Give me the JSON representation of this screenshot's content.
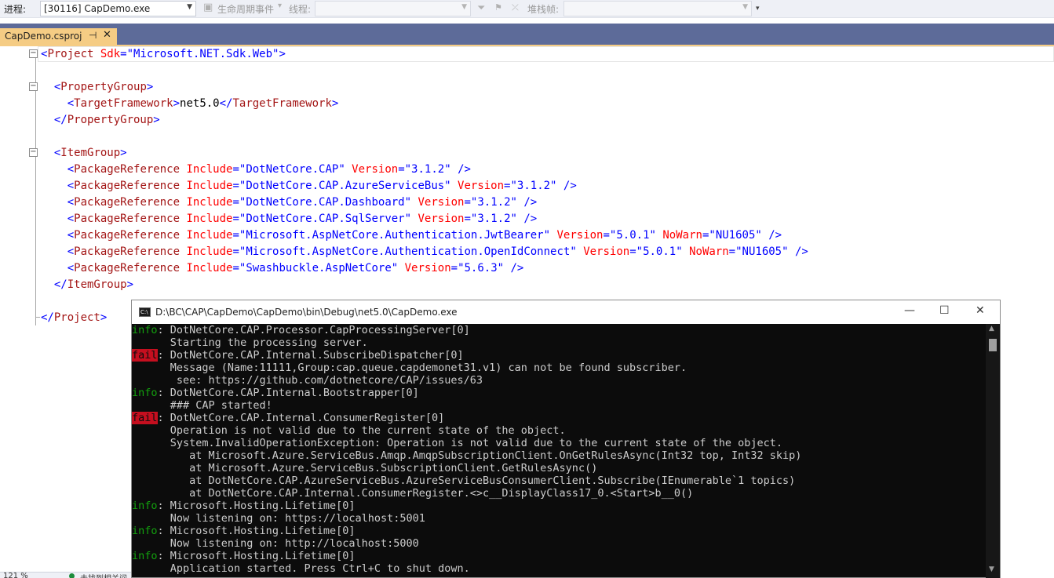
{
  "toolbar": {
    "process_label": "进程:",
    "process_value": "[30116] CapDemo.exe",
    "lifecycle_label": "生命周期事件",
    "thread_label": "线程:",
    "stackframe_label": "堆栈帧:"
  },
  "tabs": [
    {
      "label": "CapDemo.csproj",
      "active": true
    }
  ],
  "editor": {
    "lines": [
      [
        {
          "t": "<",
          "c": "br"
        },
        {
          "t": "Project",
          "c": "tag"
        },
        {
          "t": " Sdk",
          "c": "attr"
        },
        {
          "t": "=",
          "c": "br"
        },
        {
          "t": "\"Microsoft.NET.Sdk.Web\"",
          "c": "val"
        },
        {
          "t": ">",
          "c": "br"
        }
      ],
      [],
      [
        {
          "t": "  <",
          "c": "br"
        },
        {
          "t": "PropertyGroup",
          "c": "tag"
        },
        {
          "t": ">",
          "c": "br"
        }
      ],
      [
        {
          "t": "    <",
          "c": "br"
        },
        {
          "t": "TargetFramework",
          "c": "tag"
        },
        {
          "t": ">",
          "c": "br"
        },
        {
          "t": "net5.0",
          "c": "txt"
        },
        {
          "t": "</",
          "c": "br"
        },
        {
          "t": "TargetFramework",
          "c": "tag"
        },
        {
          "t": ">",
          "c": "br"
        }
      ],
      [
        {
          "t": "  </",
          "c": "br"
        },
        {
          "t": "PropertyGroup",
          "c": "tag"
        },
        {
          "t": ">",
          "c": "br"
        }
      ],
      [],
      [
        {
          "t": "  <",
          "c": "br"
        },
        {
          "t": "ItemGroup",
          "c": "tag"
        },
        {
          "t": ">",
          "c": "br"
        }
      ],
      [
        {
          "t": "    <",
          "c": "br"
        },
        {
          "t": "PackageReference",
          "c": "tag"
        },
        {
          "t": " Include",
          "c": "attr"
        },
        {
          "t": "=",
          "c": "br"
        },
        {
          "t": "\"DotNetCore.CAP\"",
          "c": "val"
        },
        {
          "t": " Version",
          "c": "attr"
        },
        {
          "t": "=",
          "c": "br"
        },
        {
          "t": "\"3.1.2\"",
          "c": "val"
        },
        {
          "t": " />",
          "c": "br"
        }
      ],
      [
        {
          "t": "    <",
          "c": "br"
        },
        {
          "t": "PackageReference",
          "c": "tag"
        },
        {
          "t": " Include",
          "c": "attr"
        },
        {
          "t": "=",
          "c": "br"
        },
        {
          "t": "\"DotNetCore.CAP.AzureServiceBus\"",
          "c": "val"
        },
        {
          "t": " Version",
          "c": "attr"
        },
        {
          "t": "=",
          "c": "br"
        },
        {
          "t": "\"3.1.2\"",
          "c": "val"
        },
        {
          "t": " />",
          "c": "br"
        }
      ],
      [
        {
          "t": "    <",
          "c": "br"
        },
        {
          "t": "PackageReference",
          "c": "tag"
        },
        {
          "t": " Include",
          "c": "attr"
        },
        {
          "t": "=",
          "c": "br"
        },
        {
          "t": "\"DotNetCore.CAP.Dashboard\"",
          "c": "val"
        },
        {
          "t": " Version",
          "c": "attr"
        },
        {
          "t": "=",
          "c": "br"
        },
        {
          "t": "\"3.1.2\"",
          "c": "val"
        },
        {
          "t": " />",
          "c": "br"
        }
      ],
      [
        {
          "t": "    <",
          "c": "br"
        },
        {
          "t": "PackageReference",
          "c": "tag"
        },
        {
          "t": " Include",
          "c": "attr"
        },
        {
          "t": "=",
          "c": "br"
        },
        {
          "t": "\"DotNetCore.CAP.SqlServer\"",
          "c": "val"
        },
        {
          "t": " Version",
          "c": "attr"
        },
        {
          "t": "=",
          "c": "br"
        },
        {
          "t": "\"3.1.2\"",
          "c": "val"
        },
        {
          "t": " />",
          "c": "br"
        }
      ],
      [
        {
          "t": "    <",
          "c": "br"
        },
        {
          "t": "PackageReference",
          "c": "tag"
        },
        {
          "t": " Include",
          "c": "attr"
        },
        {
          "t": "=",
          "c": "br"
        },
        {
          "t": "\"Microsoft.AspNetCore.Authentication.JwtBearer\"",
          "c": "val"
        },
        {
          "t": " Version",
          "c": "attr"
        },
        {
          "t": "=",
          "c": "br"
        },
        {
          "t": "\"5.0.1\"",
          "c": "val"
        },
        {
          "t": " NoWarn",
          "c": "attr"
        },
        {
          "t": "=",
          "c": "br"
        },
        {
          "t": "\"NU1605\"",
          "c": "val"
        },
        {
          "t": " />",
          "c": "br"
        }
      ],
      [
        {
          "t": "    <",
          "c": "br"
        },
        {
          "t": "PackageReference",
          "c": "tag"
        },
        {
          "t": " Include",
          "c": "attr"
        },
        {
          "t": "=",
          "c": "br"
        },
        {
          "t": "\"Microsoft.AspNetCore.Authentication.OpenIdConnect\"",
          "c": "val"
        },
        {
          "t": " Version",
          "c": "attr"
        },
        {
          "t": "=",
          "c": "br"
        },
        {
          "t": "\"5.0.1\"",
          "c": "val"
        },
        {
          "t": " NoWarn",
          "c": "attr"
        },
        {
          "t": "=",
          "c": "br"
        },
        {
          "t": "\"NU1605\"",
          "c": "val"
        },
        {
          "t": " />",
          "c": "br"
        }
      ],
      [
        {
          "t": "    <",
          "c": "br"
        },
        {
          "t": "PackageReference",
          "c": "tag"
        },
        {
          "t": " Include",
          "c": "attr"
        },
        {
          "t": "=",
          "c": "br"
        },
        {
          "t": "\"Swashbuckle.AspNetCore\"",
          "c": "val"
        },
        {
          "t": " Version",
          "c": "attr"
        },
        {
          "t": "=",
          "c": "br"
        },
        {
          "t": "\"5.6.3\"",
          "c": "val"
        },
        {
          "t": " />",
          "c": "br"
        }
      ],
      [
        {
          "t": "  </",
          "c": "br"
        },
        {
          "t": "ItemGroup",
          "c": "tag"
        },
        {
          "t": ">",
          "c": "br"
        }
      ],
      [],
      [
        {
          "t": "</",
          "c": "br"
        },
        {
          "t": "Project",
          "c": "tag"
        },
        {
          "t": ">",
          "c": "br"
        }
      ]
    ]
  },
  "console": {
    "title": "D:\\BC\\CAP\\CapDemo\\CapDemo\\bin\\Debug\\net5.0\\CapDemo.exe",
    "icon_label": "C:\\",
    "minimize_glyph": "—",
    "maximize_glyph": "☐",
    "close_glyph": "✕",
    "lines": [
      {
        "level": "info",
        "text": ": DotNetCore.CAP.Processor.CapProcessingServer[0]"
      },
      {
        "level": "",
        "text": "      Starting the processing server."
      },
      {
        "level": "fail",
        "text": ": DotNetCore.CAP.Internal.SubscribeDispatcher[0]"
      },
      {
        "level": "",
        "text": "      Message (Name:11111,Group:cap.queue.capdemonet31.v1) can not be found subscriber."
      },
      {
        "level": "",
        "text": "       see: https://github.com/dotnetcore/CAP/issues/63"
      },
      {
        "level": "info",
        "text": ": DotNetCore.CAP.Internal.Bootstrapper[0]"
      },
      {
        "level": "",
        "text": "      ### CAP started!"
      },
      {
        "level": "fail",
        "text": ": DotNetCore.CAP.Internal.ConsumerRegister[0]"
      },
      {
        "level": "",
        "text": "      Operation is not valid due to the current state of the object."
      },
      {
        "level": "",
        "text": "      System.InvalidOperationException: Operation is not valid due to the current state of the object."
      },
      {
        "level": "",
        "text": "         at Microsoft.Azure.ServiceBus.Amqp.AmqpSubscriptionClient.OnGetRulesAsync(Int32 top, Int32 skip)"
      },
      {
        "level": "",
        "text": "         at Microsoft.Azure.ServiceBus.SubscriptionClient.GetRulesAsync()"
      },
      {
        "level": "",
        "text": "         at DotNetCore.CAP.AzureServiceBus.AzureServiceBusConsumerClient.Subscribe(IEnumerable`1 topics)"
      },
      {
        "level": "",
        "text": "         at DotNetCore.CAP.Internal.ConsumerRegister.<>c__DisplayClass17_0.<Start>b__0()"
      },
      {
        "level": "info",
        "text": ": Microsoft.Hosting.Lifetime[0]"
      },
      {
        "level": "",
        "text": "      Now listening on: https://localhost:5001"
      },
      {
        "level": "info",
        "text": ": Microsoft.Hosting.Lifetime[0]"
      },
      {
        "level": "",
        "text": "      Now listening on: http://localhost:5000"
      },
      {
        "level": "info",
        "text": ": Microsoft.Hosting.Lifetime[0]"
      },
      {
        "level": "",
        "text": "      Application started. Press Ctrl+C to shut down."
      }
    ]
  },
  "status": {
    "zoom": "121 %",
    "message": "未找到相关问题"
  },
  "colors": {
    "tabstrip": "#5d6b99",
    "active_tab": "#f5cc84",
    "info": "#13a10e",
    "fail_bg": "#c50f1f",
    "console_bg": "#0c0c0c"
  }
}
